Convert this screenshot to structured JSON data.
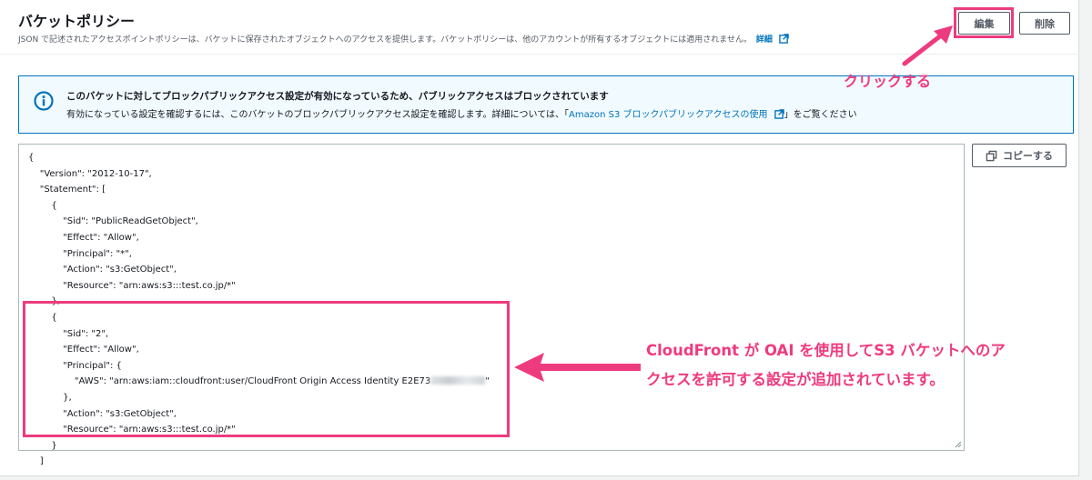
{
  "header": {
    "title": "バケットポリシー",
    "description": "JSON で記述されたアクセスポイントポリシーは、バケットに保存されたオブジェクトへのアクセスを提供します。バケットポリシーは、他のアカウントが所有するオブジェクトには適用されません。",
    "details_link": "詳細",
    "edit_label": "編集",
    "delete_label": "削除"
  },
  "annotations": {
    "click_note": "クリックする",
    "policy_note_line1": "CloudFront が OAI を使用してS3 バケットへのア",
    "policy_note_line2": "クセスを許可する設定が追加されています。",
    "accent_color": "#ee3b7f"
  },
  "alert": {
    "title": "このバケットに対してブロックパブリックアクセス設定が有効になっているため、パブリックアクセスはブロックされています",
    "body_prefix": "有効になっている設定を確認するには、このバケットのブロックパブリックアクセス設定を確認します。詳細については、「",
    "body_link": "Amazon S3 ブロックパブリックアクセスの使用",
    "body_suffix": "」をご覧ください"
  },
  "editor": {
    "copy_label": "コピーする",
    "lines": [
      "{",
      "    \"Version\": \"2012-10-17\",",
      "    \"Statement\": [",
      "        {",
      "            \"Sid\": \"PublicReadGetObject\",",
      "            \"Effect\": \"Allow\",",
      "            \"Principal\": \"*\",",
      "            \"Action\": \"s3:GetObject\",",
      "            \"Resource\": \"arn:aws:s3:::test.co.jp/*\"",
      "        },",
      "        {",
      "            \"Sid\": \"2\",",
      "            \"Effect\": \"Allow\",",
      "            \"Principal\": {",
      "                \"AWS\": \"arn:aws:iam::cloudfront:user/CloudFront Origin Access Identity E2E73",
      "            },",
      "            \"Action\": \"s3:GetObject\",",
      "            \"Resource\": \"arn:aws:s3:::test.co.jp/*\"",
      "        }",
      "    ]"
    ],
    "redacted_suffix": "\""
  }
}
